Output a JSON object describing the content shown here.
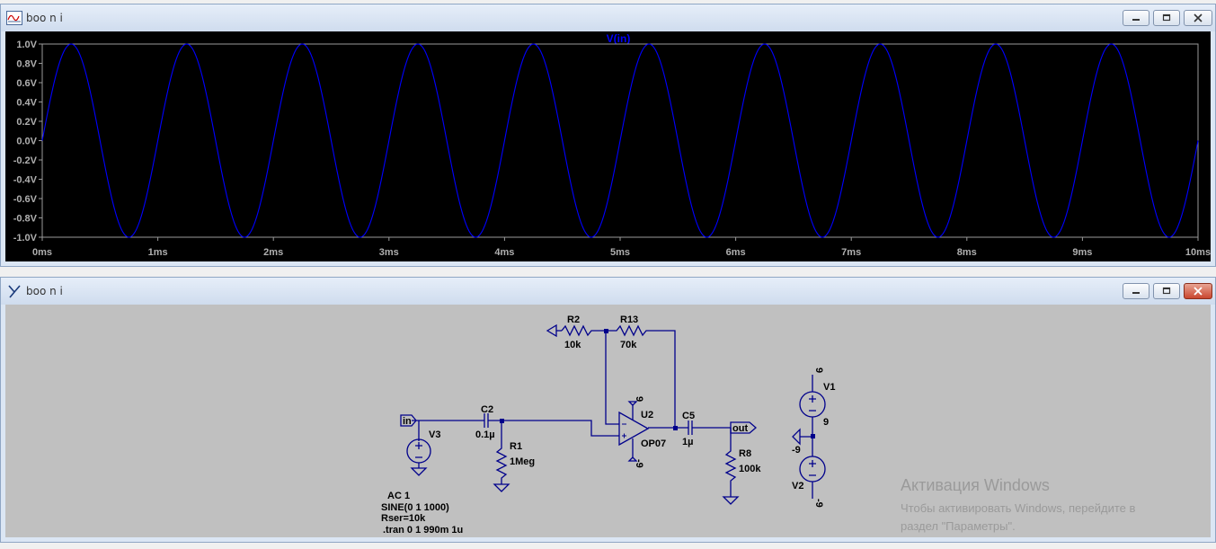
{
  "waveform_window": {
    "title": "boo n i",
    "trace_name": "V(in)",
    "trace_color": "#0000ff"
  },
  "schematic_window": {
    "title": "boo n i",
    "wire_color": "#00008b"
  },
  "chart_data": {
    "type": "line",
    "title": "V(in)",
    "xlabel": "",
    "ylabel": "",
    "xlim": [
      0,
      10
    ],
    "ylim": [
      -1.0,
      1.0
    ],
    "x_ticks": [
      "0ms",
      "1ms",
      "2ms",
      "3ms",
      "4ms",
      "5ms",
      "6ms",
      "7ms",
      "8ms",
      "9ms",
      "10ms"
    ],
    "y_ticks": [
      "1.0V",
      "0.8V",
      "0.6V",
      "0.4V",
      "0.2V",
      "0.0V",
      "-0.2V",
      "-0.4V",
      "-0.6V",
      "-0.8V",
      "-1.0V"
    ],
    "grid": false,
    "series": [
      {
        "name": "V(in)",
        "function": "sine",
        "amplitude_V": 1,
        "offset_V": 0,
        "frequency_Hz": 1000
      }
    ]
  },
  "schematic": {
    "r2": {
      "name": "R2",
      "value": "10k"
    },
    "r13": {
      "name": "R13",
      "value": "70k"
    },
    "r1": {
      "name": "R1",
      "value": "1Meg"
    },
    "r8": {
      "name": "R8",
      "value": "100k"
    },
    "c2": {
      "name": "C2",
      "value": "0.1µ"
    },
    "c5": {
      "name": "C5",
      "value": "1µ"
    },
    "u2": {
      "name": "U2",
      "value": "OP07"
    },
    "v1": {
      "name": "V1",
      "value": "9"
    },
    "v2": {
      "name": "V2",
      "value": "-9"
    },
    "v3": {
      "name": "V3"
    },
    "net_in": "in",
    "net_out": "out",
    "rail_pos": "9",
    "rail_neg": "-9",
    "directives": [
      "AC 1",
      "SINE(0 1 1000)",
      "Rser=10k",
      ".tran 0 1 990m 1u"
    ]
  },
  "watermark": {
    "title": "Активация Windows",
    "line1": "Чтобы активировать Windows, перейдите в",
    "line2": "раздел \"Параметры\"."
  }
}
